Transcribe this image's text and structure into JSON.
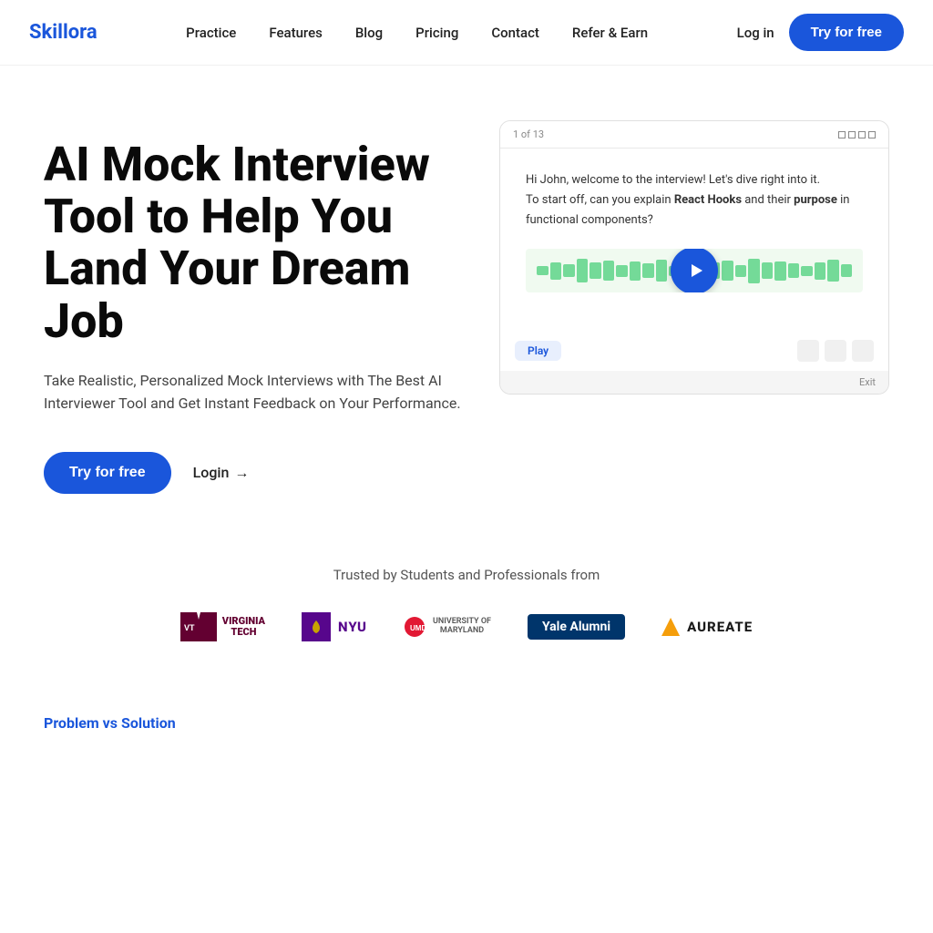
{
  "brand": {
    "name": "Skillora",
    "color": "#1a56db"
  },
  "nav": {
    "links": [
      {
        "id": "practice",
        "label": "Practice"
      },
      {
        "id": "features",
        "label": "Features"
      },
      {
        "id": "blog",
        "label": "Blog"
      },
      {
        "id": "pricing",
        "label": "Pricing"
      },
      {
        "id": "contact",
        "label": "Contact"
      },
      {
        "id": "refer",
        "label": "Refer & Earn"
      }
    ],
    "login_label": "Log in",
    "try_label": "Try for free"
  },
  "hero": {
    "title": "AI Mock Interview Tool to Help You Land Your Dream Job",
    "subtitle": "Take Realistic, Personalized Mock Interviews with The Best AI Interviewer Tool and Get Instant Feedback on Your Performance.",
    "cta_primary": "Try for free",
    "cta_secondary": "Login",
    "video_counter": "1 of 13",
    "interview_text_1": "Hi John, welcome to the interview! Let's dive right into it.",
    "interview_text_2": "To start off, can you explain ",
    "interview_text_highlight1": "React Hooks",
    "interview_text_3": " and their ",
    "interview_text_highlight2": "purpose",
    "interview_text_4": " in functional components?",
    "play_label": "Play",
    "exit_label": "Exit"
  },
  "trusted": {
    "text": "Trusted by Students and Professionals from",
    "logos": [
      {
        "id": "virginia-tech",
        "name": "Virginia Tech"
      },
      {
        "id": "nyu",
        "name": "NYU"
      },
      {
        "id": "umd",
        "name": "University of Maryland"
      },
      {
        "id": "yale",
        "name": "Yale Alumni"
      },
      {
        "id": "aureate",
        "name": "AUREATE"
      }
    ]
  },
  "problem": {
    "label": "Problem vs Solution"
  }
}
